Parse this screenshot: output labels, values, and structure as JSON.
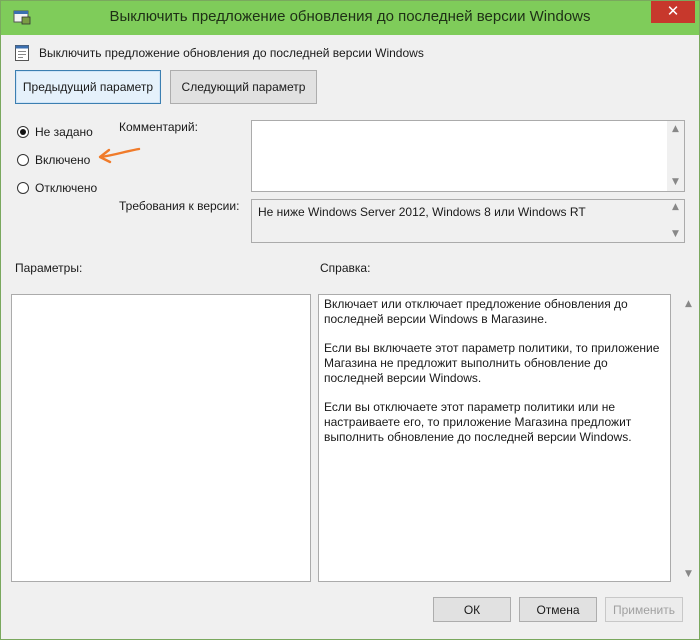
{
  "window": {
    "title": "Выключить предложение обновления до последней версии Windows",
    "close_glyph": "✕"
  },
  "policy": {
    "name": "Выключить предложение обновления до последней версии Windows"
  },
  "nav": {
    "prev_label": "Предыдущий параметр",
    "next_label": "Следующий параметр"
  },
  "state": {
    "options": [
      {
        "label": "Не задано",
        "checked": true
      },
      {
        "label": "Включено",
        "checked": false
      },
      {
        "label": "Отключено",
        "checked": false
      }
    ]
  },
  "comment": {
    "label": "Комментарий:",
    "value": ""
  },
  "requirements": {
    "label": "Требования к версии:",
    "value": "Не ниже Windows Server 2012, Windows 8 или Windows RT"
  },
  "options_panel": {
    "label": "Параметры:"
  },
  "help_panel": {
    "label": "Справка:",
    "paragraphs": [
      "Включает или отключает предложение обновления до последней версии Windows в Магазине.",
      "Если вы включаете этот параметр политики, то приложение Магазина не предложит выполнить обновление до последней версии Windows.",
      "Если вы отключаете этот параметр политики или не настраиваете его, то приложение Магазина предложит выполнить обновление до последней версии Windows."
    ]
  },
  "buttons": {
    "ok": "ОК",
    "cancel": "Отмена",
    "apply": "Применить"
  },
  "colors": {
    "titlebar": "#7fcc5a",
    "close": "#c7382c",
    "annotation_arrow": "#f07b2a"
  }
}
